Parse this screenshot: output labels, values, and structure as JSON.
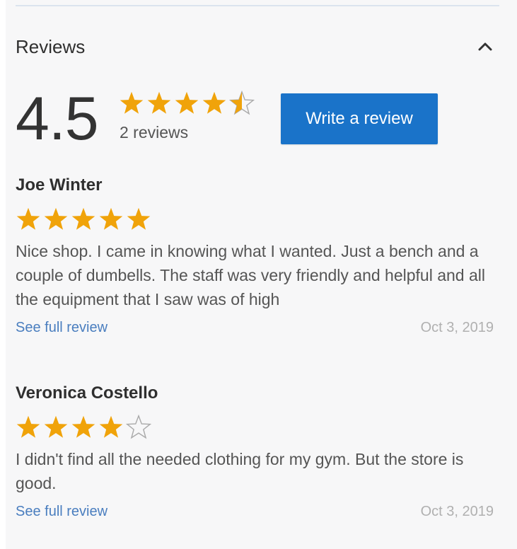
{
  "section": {
    "title": "Reviews",
    "collapse_icon": "chevron-up-icon"
  },
  "summary": {
    "average": "4.5",
    "rating_value": 4.5,
    "rating_max": 5,
    "count_text": "2 reviews",
    "write_button": "Write a review"
  },
  "colors": {
    "star_filled": "#f0a30a",
    "star_empty": "#aaaaaa",
    "button_bg": "#1a73c9",
    "link": "#4a7ebf"
  },
  "reviews": [
    {
      "author": "Joe Winter",
      "rating": 5,
      "text": "Nice shop. I came in knowing what I wanted. Just a bench and a couple of dumbells. The staff was very friendly and helpful and all the equipment that I saw was of high",
      "link": "See full review",
      "date": "Oct 3, 2019"
    },
    {
      "author": "Veronica Costello",
      "rating": 4,
      "text": "I didn't find all the needed clothing for my gym. But the store is good.",
      "link": "See full review",
      "date": "Oct 3, 2019"
    }
  ]
}
